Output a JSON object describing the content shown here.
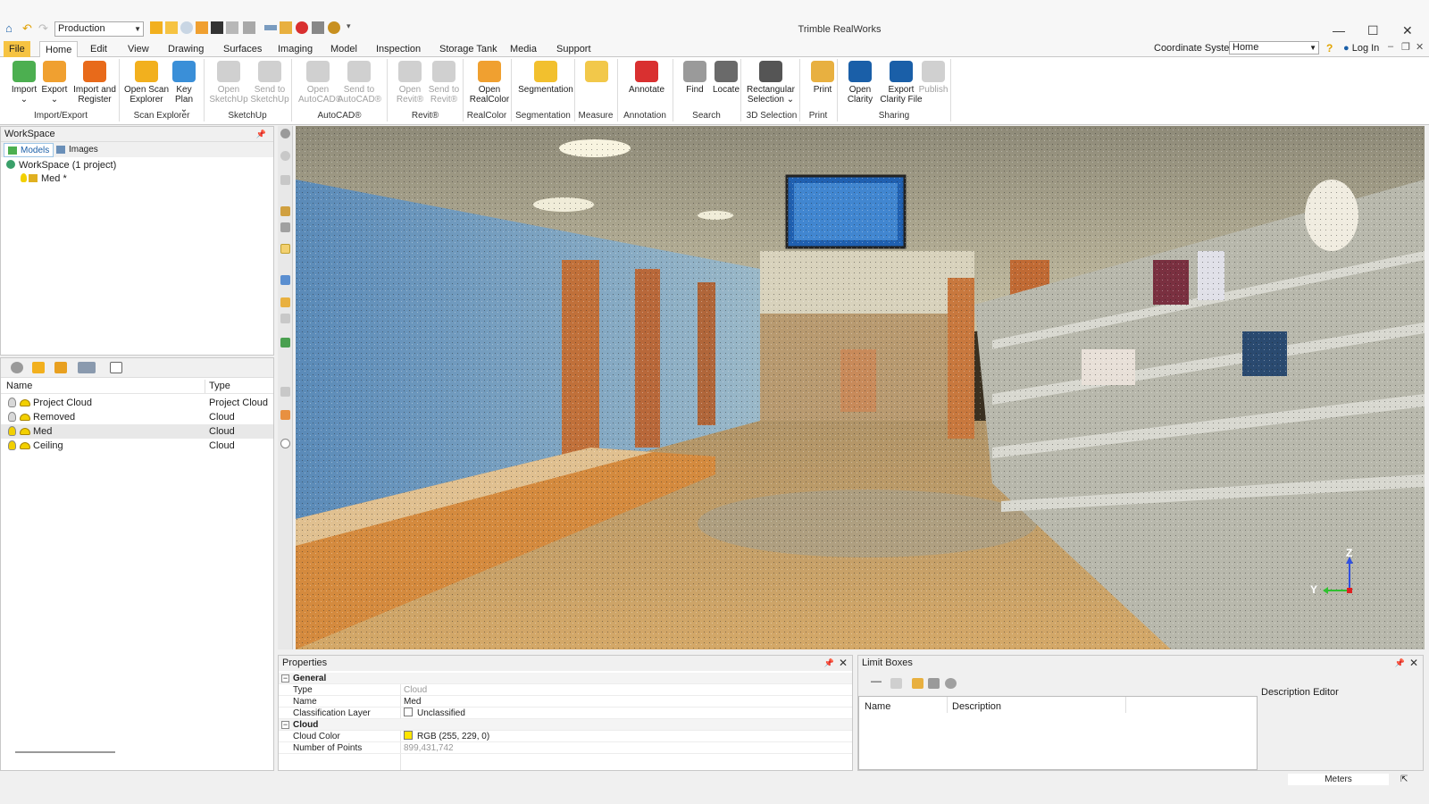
{
  "app": {
    "title": "Trimble RealWorks",
    "profile": "Production",
    "coordinate_system_label": "Coordinate System",
    "coordinate_system_value": "Home",
    "login": "Log In"
  },
  "menu_tabs": [
    "File",
    "Home",
    "Edit",
    "View",
    "Drawing",
    "Surfaces",
    "Imaging",
    "Model",
    "Inspection",
    "Storage Tank",
    "Media",
    "Support"
  ],
  "ribbon": {
    "buttons": [
      {
        "id": "import",
        "label": "Import",
        "label2": "⌄",
        "enabled": true,
        "color": "#4caf50"
      },
      {
        "id": "export",
        "label": "Export",
        "label2": "⌄",
        "enabled": true,
        "color": "#f0a030"
      },
      {
        "id": "import-register",
        "label": "Import and",
        "label2": "Register",
        "enabled": true,
        "color": "#e86a1a"
      },
      {
        "id": "open-scan-explorer",
        "label": "Open Scan",
        "label2": "Explorer",
        "enabled": true,
        "color": "#f2b01e"
      },
      {
        "id": "key-plan",
        "label": "Key",
        "label2": "Plan ⌄",
        "enabled": true,
        "color": "#3a8fd8"
      },
      {
        "id": "open-sketchup",
        "label": "Open",
        "label2": "SketchUp",
        "enabled": false,
        "color": "#888"
      },
      {
        "id": "send-sketchup",
        "label": "Send to",
        "label2": "SketchUp",
        "enabled": false,
        "color": "#888"
      },
      {
        "id": "open-autocad",
        "label": "Open",
        "label2": "AutoCAD®",
        "enabled": false,
        "color": "#888"
      },
      {
        "id": "send-autocad",
        "label": "Send to",
        "label2": "AutoCAD®",
        "enabled": false,
        "color": "#888"
      },
      {
        "id": "open-revit",
        "label": "Open",
        "label2": "Revit®",
        "enabled": false,
        "color": "#888"
      },
      {
        "id": "send-revit",
        "label": "Send to",
        "label2": "Revit®",
        "enabled": false,
        "color": "#888"
      },
      {
        "id": "open-realcolor",
        "label": "Open",
        "label2": "RealColor",
        "enabled": true,
        "color": "#f0a030"
      },
      {
        "id": "segmentation",
        "label": "Segmentation",
        "label2": "",
        "enabled": true,
        "color": "#f2c02e"
      },
      {
        "id": "measure",
        "label": "",
        "label2": "",
        "enabled": true,
        "color": "#f2c84a"
      },
      {
        "id": "annotate",
        "label": "Annotate",
        "label2": "",
        "enabled": true,
        "color": "#d93030"
      },
      {
        "id": "find",
        "label": "Find",
        "label2": "",
        "enabled": true,
        "color": "#9a9a9a"
      },
      {
        "id": "locate",
        "label": "Locate",
        "label2": "",
        "enabled": true,
        "color": "#6a6a6a"
      },
      {
        "id": "rect-selection",
        "label": "Rectangular",
        "label2": "Selection ⌄",
        "enabled": true,
        "color": "#555"
      },
      {
        "id": "print",
        "label": "Print",
        "label2": "",
        "enabled": true,
        "color": "#e8b040"
      },
      {
        "id": "open-clarity",
        "label": "Open",
        "label2": "Clarity",
        "enabled": true,
        "color": "#1a5fa8"
      },
      {
        "id": "export-clarity",
        "label": "Export",
        "label2": "Clarity File",
        "enabled": true,
        "color": "#1a5fa8"
      },
      {
        "id": "publish",
        "label": "Publish",
        "label2": "",
        "enabled": false,
        "color": "#888"
      }
    ],
    "groups": [
      "Import/Export",
      "Scan Explorer",
      "SketchUp",
      "AutoCAD®",
      "Revit®",
      "RealColor",
      "Segmentation",
      "Measure",
      "Annotation",
      "Search",
      "3D Selection",
      "Print",
      "Sharing"
    ]
  },
  "workspace": {
    "title": "WorkSpace",
    "tabs": [
      "Models",
      "Images"
    ],
    "root": "WorkSpace  (1 project)",
    "project": "Med",
    "project_marker": "*"
  },
  "layers": {
    "columns": [
      "Name",
      "Type"
    ],
    "rows": [
      {
        "name": "Project Cloud",
        "type": "Project Cloud",
        "bulb": "#d8d8d8"
      },
      {
        "name": "Removed",
        "type": "Cloud",
        "bulb": "#d8d8d8"
      },
      {
        "name": "Med",
        "type": "Cloud",
        "bulb": "#f2d000"
      },
      {
        "name": "Ceiling",
        "type": "Cloud",
        "bulb": "#f2d000"
      }
    ]
  },
  "viewport": {
    "axis_z": "Z",
    "axis_y": "Y"
  },
  "properties": {
    "title": "Properties",
    "rows": [
      {
        "kind": "cat",
        "key": "General"
      },
      {
        "kind": "row",
        "key": "Type",
        "value": "Cloud",
        "grey": true
      },
      {
        "kind": "row",
        "key": "Name",
        "value": "Med"
      },
      {
        "kind": "row",
        "key": "Classification Layer",
        "value": "Unclassified",
        "swatch": "#ffffff"
      },
      {
        "kind": "cat",
        "key": "Cloud"
      },
      {
        "kind": "row",
        "key": "Cloud Color",
        "value": "RGB (255, 229, 0)",
        "swatch": "#ffe500"
      },
      {
        "kind": "row",
        "key": "Number of Points",
        "value": "899,431,742",
        "grey": true
      }
    ]
  },
  "limit_boxes": {
    "title": "Limit Boxes",
    "columns": [
      "Name",
      "Description"
    ],
    "description_editor": "Description Editor"
  },
  "status": {
    "units": "Meters"
  }
}
